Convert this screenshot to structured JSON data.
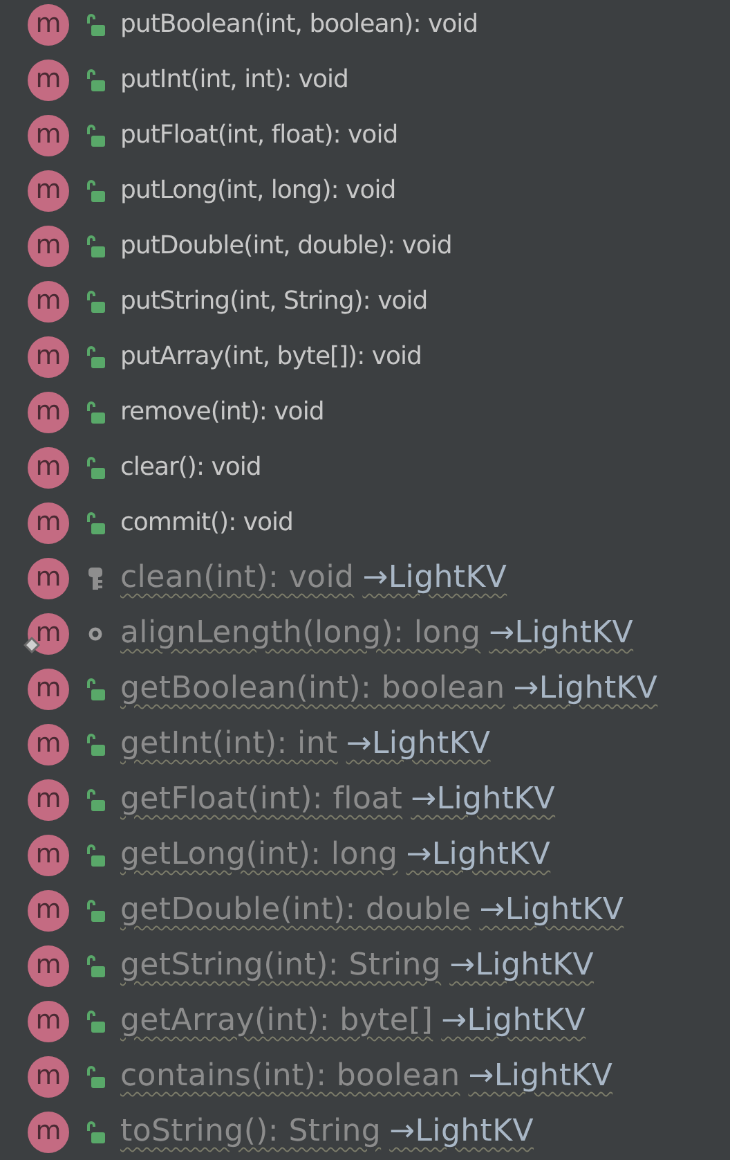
{
  "members": [
    {
      "badge": "m",
      "kind": "public",
      "static": false,
      "inherited": false,
      "signature": "putBoolean(int, boolean): void"
    },
    {
      "badge": "m",
      "kind": "public",
      "static": false,
      "inherited": false,
      "signature": "putInt(int, int): void"
    },
    {
      "badge": "m",
      "kind": "public",
      "static": false,
      "inherited": false,
      "signature": "putFloat(int, float): void"
    },
    {
      "badge": "m",
      "kind": "public",
      "static": false,
      "inherited": false,
      "signature": "putLong(int, long): void"
    },
    {
      "badge": "m",
      "kind": "public",
      "static": false,
      "inherited": false,
      "signature": "putDouble(int, double): void"
    },
    {
      "badge": "m",
      "kind": "public",
      "static": false,
      "inherited": false,
      "signature": "putString(int, String): void"
    },
    {
      "badge": "m",
      "kind": "public",
      "static": false,
      "inherited": false,
      "signature": "putArray(int, byte[]): void"
    },
    {
      "badge": "m",
      "kind": "public",
      "static": false,
      "inherited": false,
      "signature": "remove(int): void"
    },
    {
      "badge": "m",
      "kind": "public",
      "static": false,
      "inherited": false,
      "signature": "clear(): void"
    },
    {
      "badge": "m",
      "kind": "public",
      "static": false,
      "inherited": false,
      "signature": "commit(): void"
    },
    {
      "badge": "m",
      "kind": "private",
      "static": false,
      "inherited": true,
      "signature": "clean(int): void",
      "owner": "→LightKV"
    },
    {
      "badge": "m",
      "kind": "package",
      "static": true,
      "inherited": true,
      "signature": "alignLength(long): long",
      "owner": "→LightKV"
    },
    {
      "badge": "m",
      "kind": "public",
      "static": false,
      "inherited": true,
      "signature": "getBoolean(int): boolean",
      "owner": "→LightKV"
    },
    {
      "badge": "m",
      "kind": "public",
      "static": false,
      "inherited": true,
      "signature": "getInt(int): int",
      "owner": "→LightKV"
    },
    {
      "badge": "m",
      "kind": "public",
      "static": false,
      "inherited": true,
      "signature": "getFloat(int): float",
      "owner": "→LightKV"
    },
    {
      "badge": "m",
      "kind": "public",
      "static": false,
      "inherited": true,
      "signature": "getLong(int): long",
      "owner": "→LightKV"
    },
    {
      "badge": "m",
      "kind": "public",
      "static": false,
      "inherited": true,
      "signature": "getDouble(int): double",
      "owner": "→LightKV"
    },
    {
      "badge": "m",
      "kind": "public",
      "static": false,
      "inherited": true,
      "signature": "getString(int): String",
      "owner": "→LightKV"
    },
    {
      "badge": "m",
      "kind": "public",
      "static": false,
      "inherited": true,
      "signature": "getArray(int): byte[]",
      "owner": "→LightKV"
    },
    {
      "badge": "m",
      "kind": "public",
      "static": false,
      "inherited": true,
      "signature": "contains(int): boolean",
      "owner": "→LightKV"
    },
    {
      "badge": "m",
      "kind": "public",
      "static": false,
      "inherited": true,
      "signature": "toString(): String",
      "owner": "→LightKV"
    }
  ]
}
